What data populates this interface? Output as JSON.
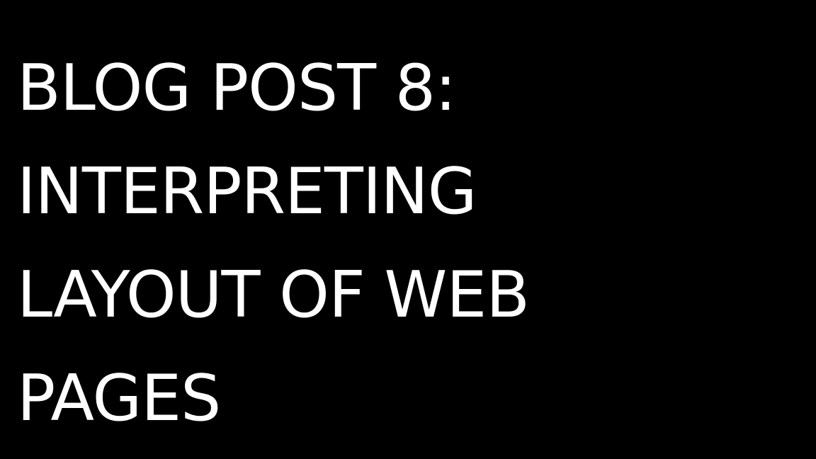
{
  "slide": {
    "background": "#000000",
    "text_color": "#ffffff",
    "title_lines": [
      "BLOG POST 8:",
      "INTERPRETING",
      "LAYOUT OF WEB",
      "PAGES"
    ]
  }
}
